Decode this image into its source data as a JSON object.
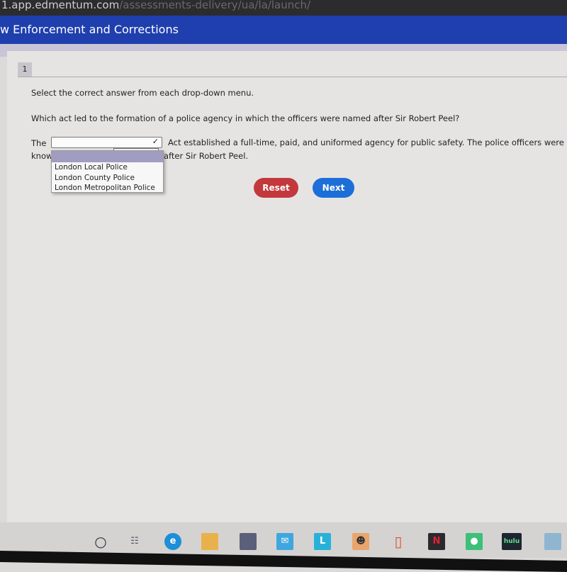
{
  "browser": {
    "url_host": "1.app.edmentum.com",
    "url_path": "/assessments-delivery/ua/la/launch/"
  },
  "header": {
    "title": "w Enforcement and Corrections"
  },
  "question": {
    "number": "1",
    "instruction": "Select the correct answer from each drop-down menu.",
    "prompt": "Which act led to the formation of a police agency in which the officers were named after Sir Robert Peel?",
    "line1_before": "The",
    "line1_after": "Act established a full-time, paid, and uniformed agency for public safety. The police officers were",
    "line2_before": "know",
    "line2_after": "after Sir Robert Peel.",
    "dropdown1": {
      "selected": "",
      "options": [
        "London Local Police",
        "London County Police",
        "London Metropolitan Police"
      ]
    }
  },
  "buttons": {
    "reset": "Reset",
    "next": "Next"
  },
  "taskbar": {
    "icons": [
      "search-icon",
      "task-view-icon",
      "edge-icon",
      "file-explorer-icon",
      "store-icon",
      "mail-icon",
      "l-app-icon",
      "app-icon",
      "office-icon",
      "netflix-icon",
      "spotify-icon",
      "hulu-icon",
      "installer-icon"
    ],
    "netflix": "N",
    "hulu": "hulu",
    "l_app": "L"
  },
  "colors": {
    "header": "#1f3fae",
    "reset": "#c3383c",
    "next": "#1c6fd8",
    "highlight": "#a19dc0"
  }
}
